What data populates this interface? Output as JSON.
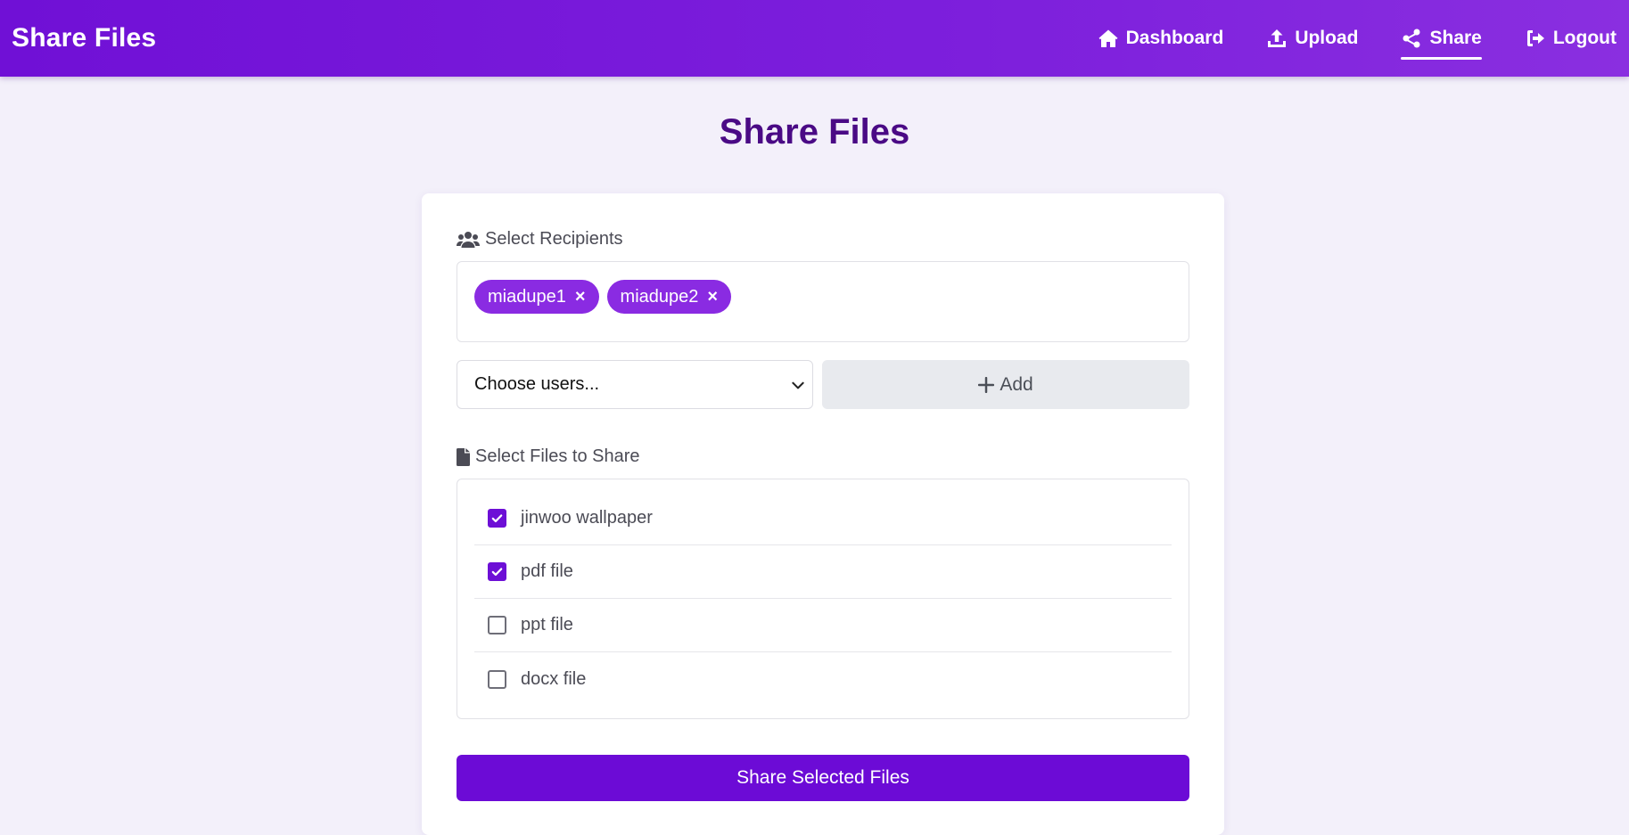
{
  "app": {
    "brand": "Share Files"
  },
  "nav": {
    "items": [
      {
        "label": "Dashboard",
        "icon": "home-icon",
        "active": false
      },
      {
        "label": "Upload",
        "icon": "upload-icon",
        "active": false
      },
      {
        "label": "Share",
        "icon": "share-icon",
        "active": true
      },
      {
        "label": "Logout",
        "icon": "logout-icon",
        "active": false
      }
    ]
  },
  "page": {
    "title": "Share Files"
  },
  "recipients": {
    "label": "Select Recipients",
    "icon": "users-icon",
    "selected": [
      {
        "name": "miadupe1",
        "remove": "×"
      },
      {
        "name": "miadupe2",
        "remove": "×"
      }
    ],
    "select_value": "Choose users...",
    "add_label": "Add"
  },
  "files": {
    "label": "Select Files to Share",
    "icon": "file-icon",
    "items": [
      {
        "name": "jinwoo wallpaper",
        "checked": true
      },
      {
        "name": "pdf file",
        "checked": true
      },
      {
        "name": "ppt file",
        "checked": false
      },
      {
        "name": "docx file",
        "checked": false
      }
    ]
  },
  "actions": {
    "share_label": "Share Selected Files"
  },
  "colors": {
    "accent": "#6c0bd6",
    "chip": "#8a2be2",
    "title": "#4a0a85",
    "background": "#f3f0fa"
  }
}
